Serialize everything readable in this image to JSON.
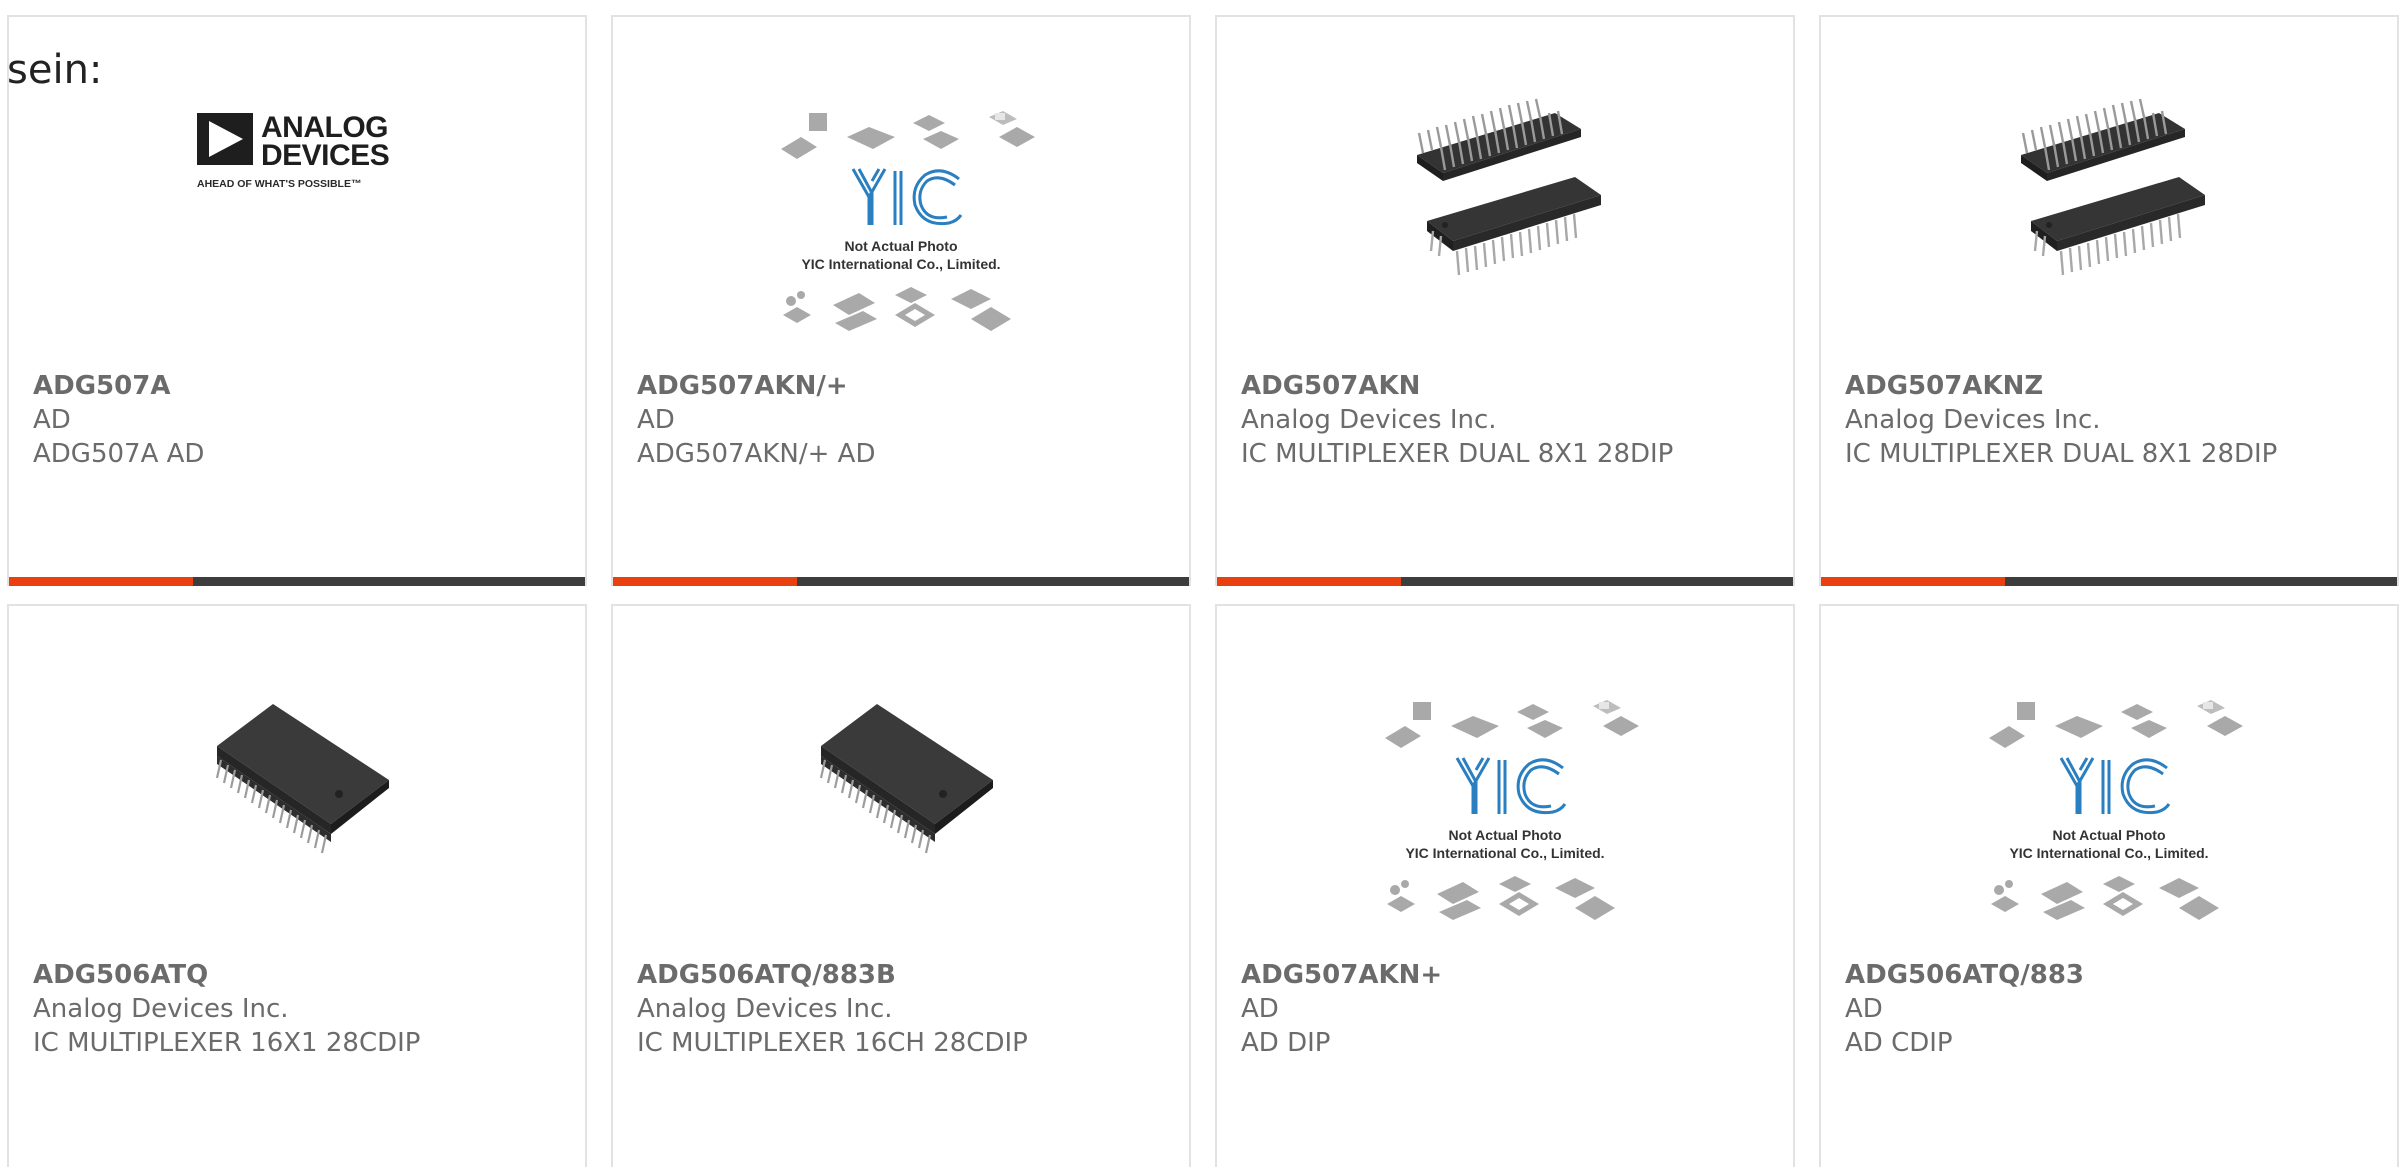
{
  "leading_text": "sein:",
  "accent_color": "#e8400f",
  "bar_color": "#3d3d3d",
  "placeholder_text": {
    "line1": "Not Actual Photo",
    "line2": "YIC International Co., Limited.",
    "logo": "YIC"
  },
  "brand_logo": {
    "line1": "ANALOG",
    "line2": "DEVICES",
    "tagline": "AHEAD OF WHAT'S POSSIBLE™"
  },
  "products": [
    {
      "part": "ADG507A",
      "maker": "AD",
      "desc": "ADG507A AD",
      "image": "analog-devices-logo-image"
    },
    {
      "part": "ADG507AKN/+",
      "maker": "AD",
      "desc": "ADG507AKN/+ AD",
      "image": "not-actual-photo-placeholder-image"
    },
    {
      "part": "ADG507AKN",
      "maker": "Analog Devices Inc.",
      "desc": "IC MULTIPLEXER DUAL 8X1 28DIP",
      "image": "dip-chip-pins-up-image"
    },
    {
      "part": "ADG507AKNZ",
      "maker": "Analog Devices Inc.",
      "desc": "IC MULTIPLEXER DUAL 8X1 28DIP",
      "image": "dip-chip-pins-up-image"
    },
    {
      "part": "ADG506ATQ",
      "maker": "Analog Devices Inc.",
      "desc": "IC MULTIPLEXER 16X1 28CDIP",
      "image": "dip-chip-image"
    },
    {
      "part": "ADG506ATQ/883B",
      "maker": "Analog Devices Inc.",
      "desc": "IC MULTIPLEXER 16CH 28CDIP",
      "image": "dip-chip-image"
    },
    {
      "part": "ADG507AKN+",
      "maker": "AD",
      "desc": "AD DIP",
      "image": "not-actual-photo-placeholder-image"
    },
    {
      "part": "ADG506ATQ/883",
      "maker": "AD",
      "desc": "AD CDIP",
      "image": "not-actual-photo-placeholder-image"
    }
  ]
}
